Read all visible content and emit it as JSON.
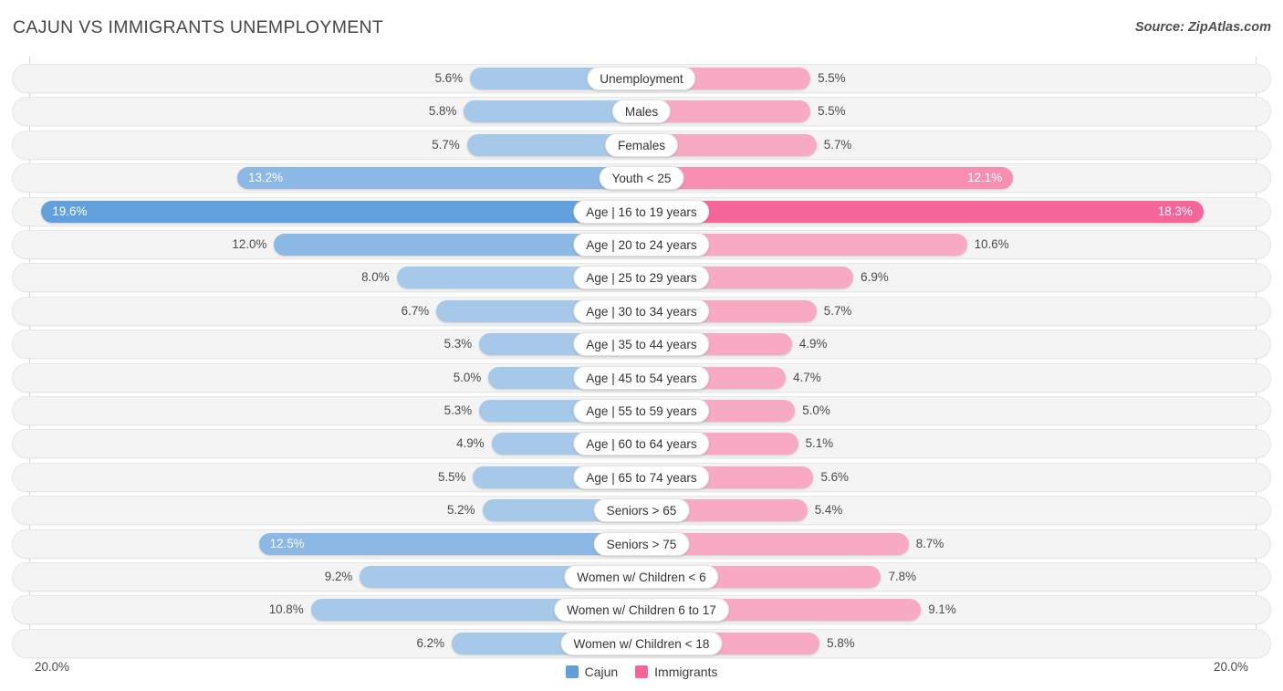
{
  "header": {
    "title": "CAJUN VS IMMIGRANTS UNEMPLOYMENT",
    "source": "Source: ZipAtlas.com"
  },
  "legend": {
    "items": [
      {
        "label": "Cajun",
        "color": "#62a0dd"
      },
      {
        "label": "Immigrants",
        "color": "#f4659a"
      }
    ]
  },
  "axis": {
    "left_tick": "20.0%",
    "right_tick": "20.0%",
    "max": 20.0
  },
  "chart_data": {
    "type": "bar",
    "orientation": "horizontal-diverging",
    "title": "CAJUN VS IMMIGRANTS UNEMPLOYMENT",
    "subtitle": "",
    "xlabel": "",
    "ylabel": "",
    "xlim": [
      20.0,
      20.0
    ],
    "grid": false,
    "legend_position": "bottom-center",
    "categories": [
      "Unemployment",
      "Males",
      "Females",
      "Youth < 25",
      "Age | 16 to 19 years",
      "Age | 20 to 24 years",
      "Age | 25 to 29 years",
      "Age | 30 to 34 years",
      "Age | 35 to 44 years",
      "Age | 45 to 54 years",
      "Age | 55 to 59 years",
      "Age | 60 to 64 years",
      "Age | 65 to 74 years",
      "Seniors > 65",
      "Seniors > 75",
      "Women w/ Children < 6",
      "Women w/ Children 6 to 17",
      "Women w/ Children < 18"
    ],
    "series": [
      {
        "name": "Cajun",
        "side": "left",
        "values": [
          5.6,
          5.8,
          5.7,
          13.2,
          19.6,
          12.0,
          8.0,
          6.7,
          5.3,
          5.0,
          5.3,
          4.9,
          5.5,
          5.2,
          12.5,
          9.2,
          10.8,
          6.2
        ],
        "labels": [
          "5.6%",
          "5.8%",
          "5.7%",
          "13.2%",
          "19.6%",
          "12.0%",
          "8.0%",
          "6.7%",
          "5.3%",
          "5.0%",
          "5.3%",
          "4.9%",
          "5.5%",
          "5.2%",
          "12.5%",
          "9.2%",
          "10.8%",
          "6.2%"
        ]
      },
      {
        "name": "Immigrants",
        "side": "right",
        "values": [
          5.5,
          5.5,
          5.7,
          12.1,
          18.3,
          10.6,
          6.9,
          5.7,
          4.9,
          4.7,
          5.0,
          5.1,
          5.6,
          5.4,
          8.7,
          7.8,
          9.1,
          5.8
        ],
        "labels": [
          "5.5%",
          "5.5%",
          "5.7%",
          "12.1%",
          "18.3%",
          "10.6%",
          "6.9%",
          "5.7%",
          "4.9%",
          "4.7%",
          "5.0%",
          "5.1%",
          "5.6%",
          "5.4%",
          "8.7%",
          "7.8%",
          "9.1%",
          "5.8%"
        ]
      }
    ]
  },
  "colors": {
    "left_light": "#a6c9ea",
    "left_mid": "#8bb8e4",
    "left_dark": "#62a0dd",
    "right_light": "#f8aac4",
    "right_mid": "#f88fb3",
    "right_dark": "#f4659a",
    "track": "#f4f4f4",
    "text": "#4a4a4a"
  }
}
